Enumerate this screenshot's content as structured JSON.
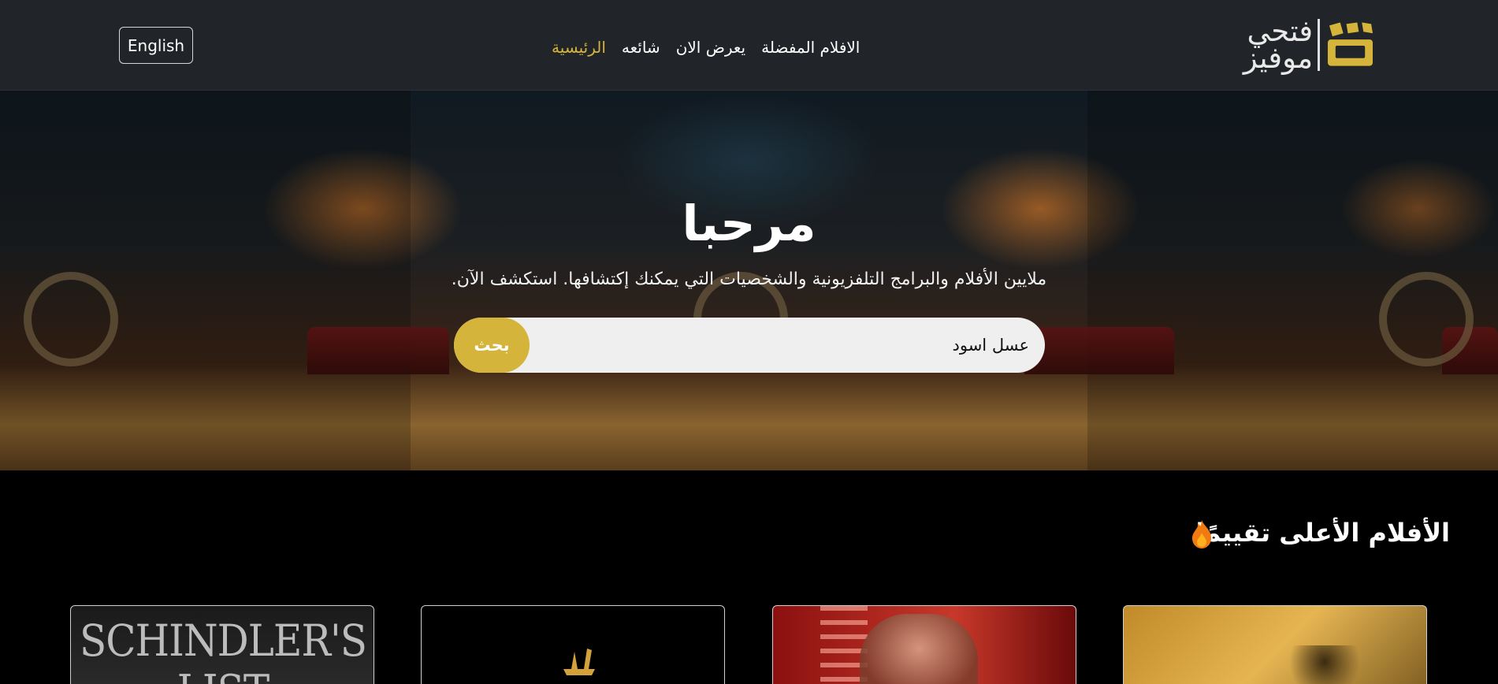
{
  "header": {
    "language_button": "English",
    "brand_name": "فتحي موفيز",
    "nav": [
      {
        "label": "الرئيسية",
        "active": true
      },
      {
        "label": "شائعه",
        "active": false
      },
      {
        "label": "يعرض الان",
        "active": false
      },
      {
        "label": "الافلام المفضلة",
        "active": false
      }
    ]
  },
  "hero": {
    "title": "مرحبا",
    "subtitle": "ملايين الأفلام والبرامج التلفزيونية والشخصيات التي يمكنك إكتشافها. استكشف الآن.",
    "search_value": "عسل اسود",
    "search_button": "بحث"
  },
  "section": {
    "title": "الأفلام الأعلى تقييمًا",
    "icon": "fire-icon"
  },
  "movies": [
    {
      "poster_text": "SCHINDLER'S LIST"
    },
    {
      "poster_text": ""
    },
    {
      "poster_text": ""
    },
    {
      "poster_text": ""
    }
  ],
  "colors": {
    "accent": "#d4b43a",
    "navbar": "#212529",
    "background": "#000000"
  }
}
